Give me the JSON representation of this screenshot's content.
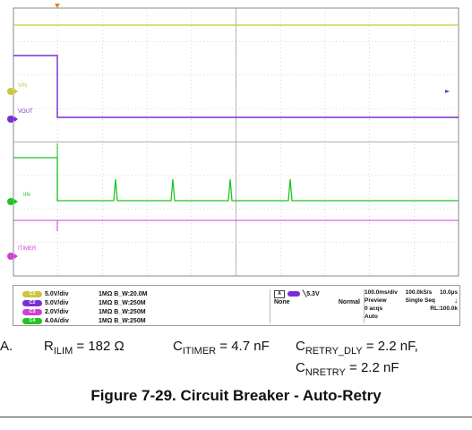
{
  "scope": {
    "channel_markers": [
      "VIN",
      "VOUT",
      "IIN",
      "ITIMER"
    ],
    "colors": {
      "ch1": "#c8c840",
      "ch2": "#7a2fd0",
      "ch3": "#d040d8",
      "ch4": "#22c322",
      "grid": "#b8b8b8",
      "background": "#ffffff"
    }
  },
  "channels": [
    {
      "badge": "C1",
      "scale": "5.0V/div",
      "impedance": "1MΩ",
      "bw": "B_W:20.0M",
      "color": "#c8c840"
    },
    {
      "badge": "C2",
      "scale": "5.0V/div",
      "impedance": "1MΩ",
      "bw": "B_W:250M",
      "color": "#7a2fd0"
    },
    {
      "badge": "C3",
      "scale": "2.0V/div",
      "impedance": "1MΩ",
      "bw": "B_W:250M",
      "color": "#d040d8"
    },
    {
      "badge": "C4",
      "scale": "4.0A/div",
      "impedance": "1MΩ",
      "bw": "B_W:250M",
      "color": "#22c322"
    }
  ],
  "trigger": {
    "source": "A",
    "level": "5.3V",
    "coupling": "None",
    "mode": "Normal"
  },
  "acquisition": {
    "timebase": "100.0ms/div",
    "sample_rate": "100.0kS/s",
    "resolution": "10.0µs",
    "state": "Preview",
    "sequence": "Single Seq",
    "acqs": "0 acqs",
    "record": "RL:100.0k",
    "trigger_mode": "Auto"
  },
  "params": {
    "leading": "A.",
    "rilim": "R",
    "rilim_sub": "ILIM",
    "rilim_val": " = 182 Ω",
    "citimer": "C",
    "citimer_sub": "ITIMER",
    "citimer_val": " = 4.7 nF",
    "cretry": "C",
    "cretry_sub": "RETRY_DLY",
    "cretry_val": " = 2.2 nF,",
    "cnretry": "C",
    "cnretry_sub": "NRETRY",
    "cnretry_val": " = 2.2 nF"
  },
  "caption": "Figure 7-29. Circuit Breaker - Auto-Retry"
}
